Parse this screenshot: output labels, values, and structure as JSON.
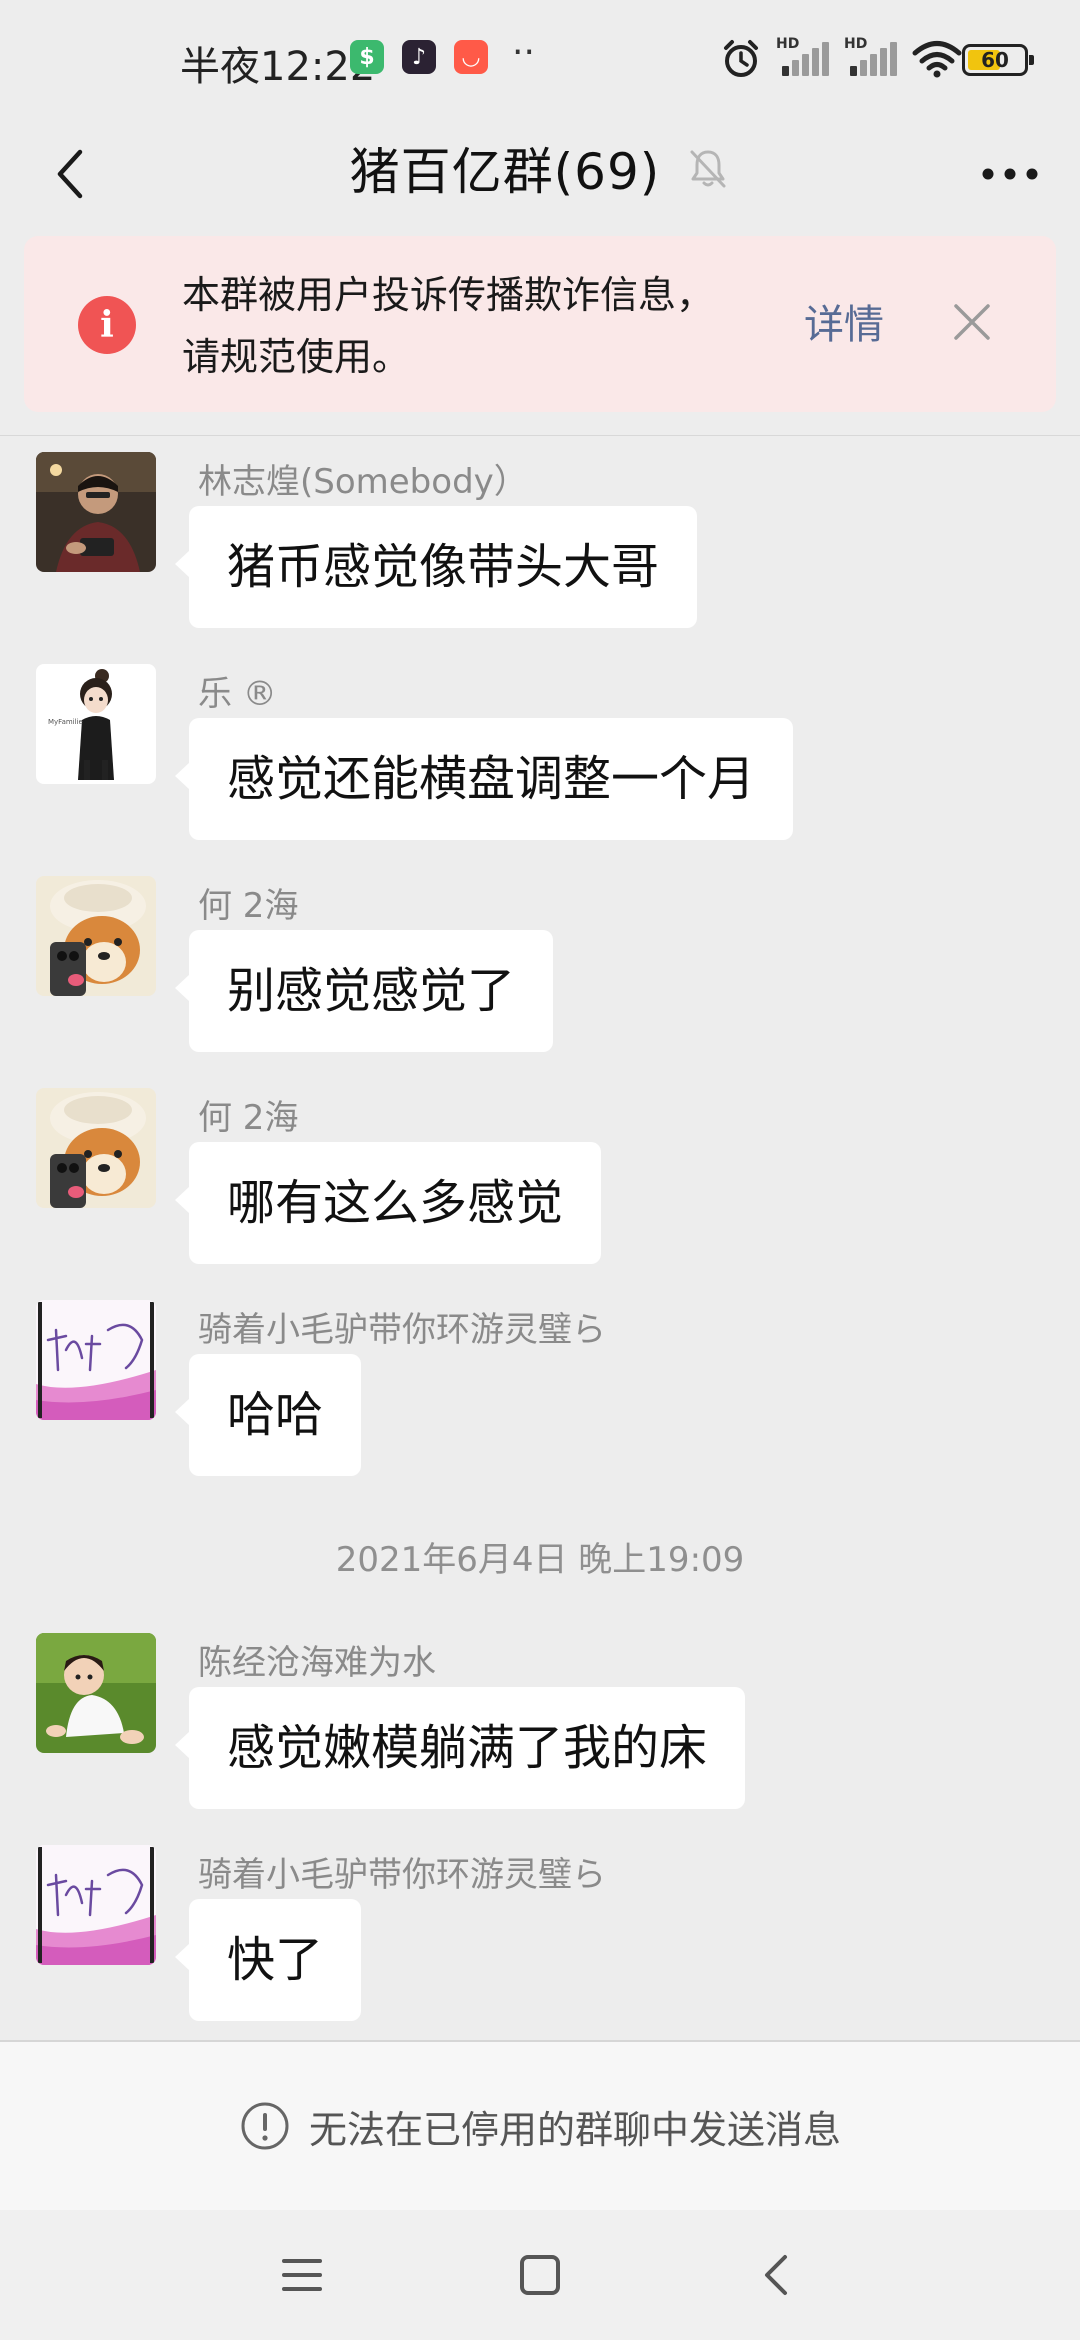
{
  "status_bar": {
    "time": "半夜12:22",
    "apps": [
      {
        "name": "money-app-icon",
        "color": "#3cb96e",
        "glyph": "$"
      },
      {
        "name": "tiktok-app-icon",
        "color": "#2b2233",
        "glyph": "♪"
      },
      {
        "name": "shopping-app-icon",
        "color": "#ff5a48",
        "glyph": "◡"
      }
    ],
    "more": "··",
    "signal1_label": "HD",
    "signal2_label": "HD",
    "battery_percent": "60",
    "battery_level": 0.6
  },
  "header": {
    "title": "猪百亿群(69)",
    "muted": true
  },
  "banner": {
    "text": "本群被用户投诉传播欺诈信息，请规范使用。",
    "detail_label": "详情",
    "info_glyph": "i"
  },
  "messages": [
    {
      "sender": "林志煌(Somebody）",
      "text": "猪币感觉像带头大哥",
      "avatar": "man-phone-avatar"
    },
    {
      "sender": "乐 ®",
      "text": "感觉还能横盘调整一个月",
      "avatar": "cartoon-girl-avatar"
    },
    {
      "sender": "何 2海",
      "text": "别感觉感觉了",
      "avatar": "shiba-dog-avatar"
    },
    {
      "sender": "何 2海",
      "text": "哪有这么多感觉",
      "avatar": "shiba-dog-avatar"
    },
    {
      "sender": "骑着小毛驴带你环游灵璧ら",
      "text": "哈哈",
      "avatar": "signature-avatar"
    }
  ],
  "timestamp": "2021年6月4日 晚上19:09",
  "messages_after": [
    {
      "sender": "陈经沧海难为水",
      "text": "感觉嫩模躺满了我的床",
      "avatar": "child-grass-avatar"
    },
    {
      "sender": "骑着小毛驴带你环游灵璧ら",
      "text": "快了",
      "avatar": "signature-avatar"
    }
  ],
  "notice": {
    "text": "无法在已停用的群聊中发送消息",
    "glyph": "!"
  },
  "nav": [
    "menu",
    "home",
    "back"
  ]
}
